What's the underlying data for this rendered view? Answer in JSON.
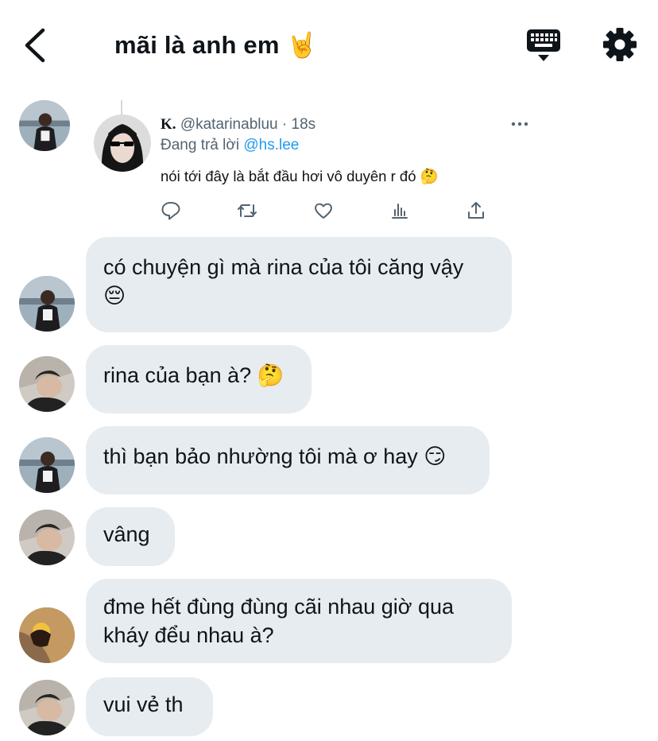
{
  "header": {
    "title": "mãi là anh em 🤘"
  },
  "tweet": {
    "display_name": "K.",
    "handle": "@katarinabluu",
    "time": "· 18s",
    "reply_prefix": "Đang trả lời ",
    "reply_handle": "@hs.lee",
    "body": "nói tới đây là bắt đầu hơi vô duyên r đó 🤔",
    "actions": [
      "reply-icon",
      "retweet-icon",
      "like-icon",
      "analytics-icon",
      "share-icon"
    ]
  },
  "messages": [
    {
      "text": "có chuyện gì mà rina của tôi căng vậy",
      "text2": "😔"
    },
    {
      "text": "rina của bạn à? 🤔"
    },
    {
      "text": "thì bạn bảo nhường tôi mà ơ hay 😏"
    },
    {
      "text": "vâng"
    },
    {
      "text": "đme hết đùng đùng cãi nhau giờ qua",
      "text2": "kháy đểu nhau à?"
    },
    {
      "text": "vui vẻ th"
    }
  ],
  "colors": {
    "bubble": "#e6ecf0",
    "link": "#1d9bf0",
    "muted": "#536471"
  }
}
